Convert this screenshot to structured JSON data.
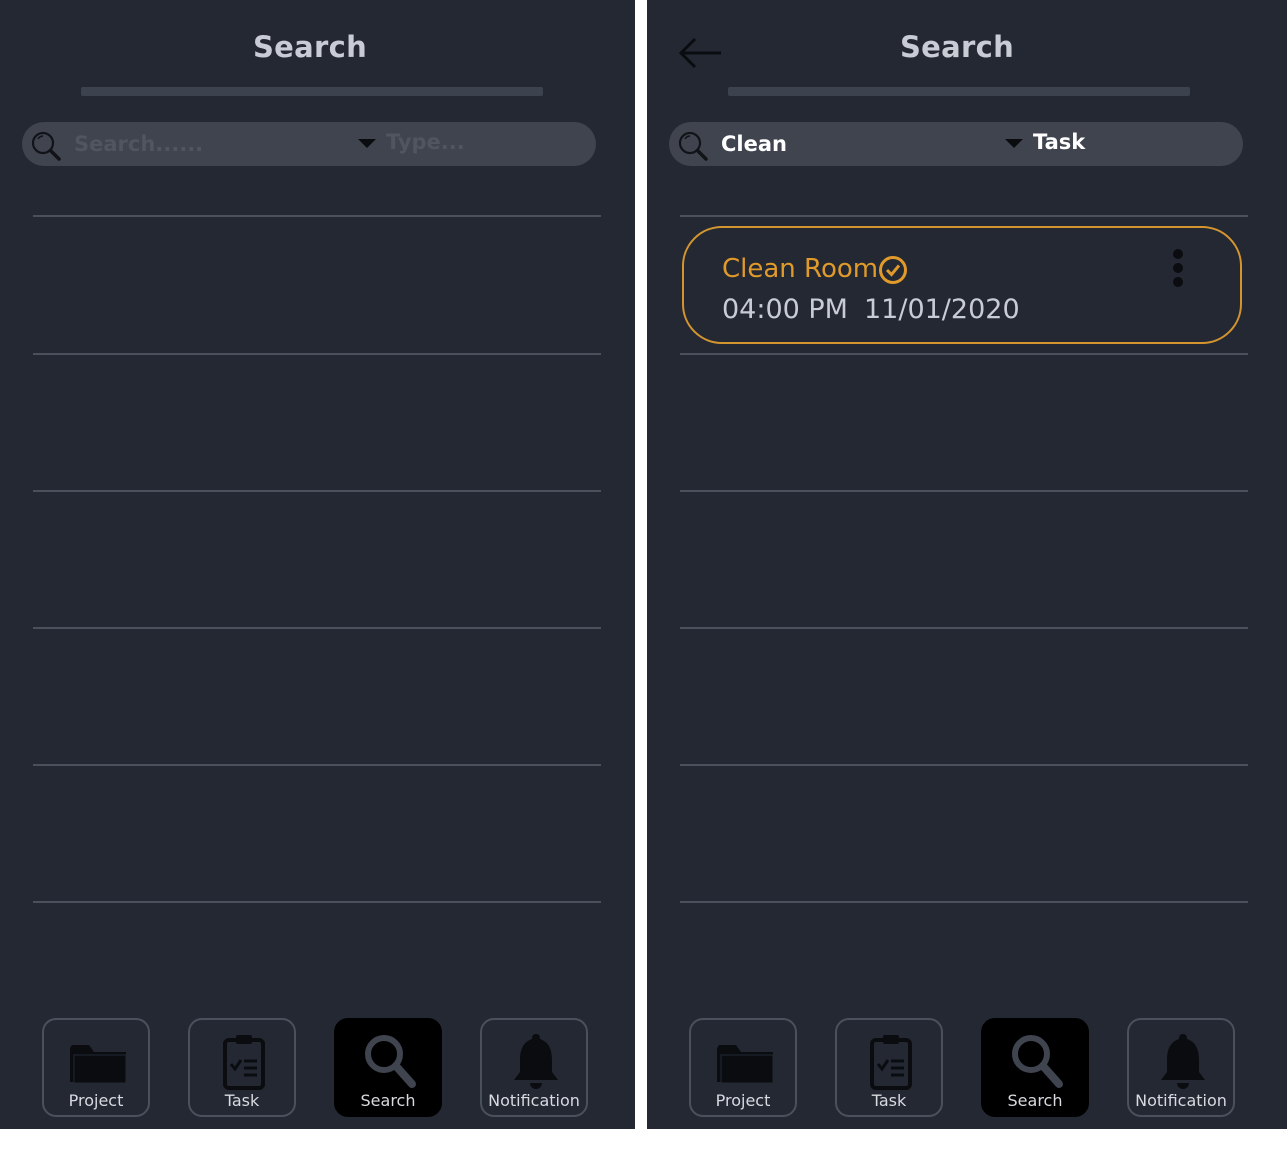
{
  "screens": [
    {
      "header": {
        "title": "Search"
      },
      "search": {
        "placeholder": "Search......",
        "value": "",
        "type_placeholder": "Type...",
        "type_value": ""
      },
      "results": [],
      "bottom_nav": [
        {
          "label": "Project",
          "icon": "folder-icon",
          "active": false
        },
        {
          "label": "Task",
          "icon": "clipboard-check-icon",
          "active": false
        },
        {
          "label": "Search",
          "icon": "search-icon",
          "active": true
        },
        {
          "label": "Notification",
          "icon": "bell-icon",
          "active": false
        }
      ]
    },
    {
      "header": {
        "title": "Search",
        "back_icon": "arrow-left-icon"
      },
      "search": {
        "placeholder": "Search......",
        "value": "Clean",
        "type_placeholder": "Type...",
        "type_value": "Task"
      },
      "results": [
        {
          "title": "Clean Room",
          "time": "04:00 PM",
          "date": "11/01/2020",
          "completed": true
        }
      ],
      "bottom_nav": [
        {
          "label": "Project",
          "icon": "folder-icon",
          "active": false
        },
        {
          "label": "Task",
          "icon": "clipboard-check-icon",
          "active": false
        },
        {
          "label": "Search",
          "icon": "search-icon",
          "active": true
        },
        {
          "label": "Notification",
          "icon": "bell-icon",
          "active": false
        }
      ]
    }
  ],
  "colors": {
    "background": "#232833",
    "search_bar": "#3f444f",
    "accent": "#d4952f",
    "text": "#c9ccd4",
    "divider": "#4a505c"
  }
}
